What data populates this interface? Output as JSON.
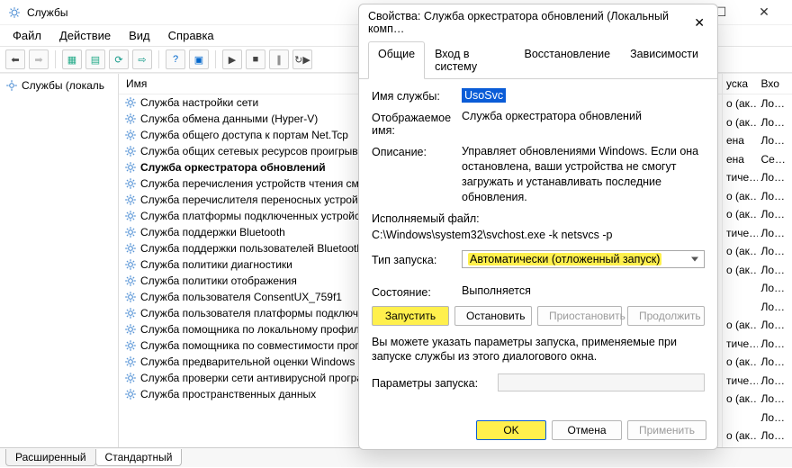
{
  "window": {
    "title": "Службы",
    "menu": [
      "Файл",
      "Действие",
      "Вид",
      "Справка"
    ]
  },
  "tree": {
    "root": "Службы (локаль"
  },
  "list_header": "Имя",
  "services": [
    "Служба настройки сети",
    "Служба обмена данными (Hyper-V)",
    "Служба общего доступа к портам Net.Tcp",
    "Служба общих сетевых ресурсов проигрыва…",
    "Служба оркестратора обновлений",
    "Служба перечисления устройств чтения см…",
    "Служба перечислителя переносных устройст…",
    "Служба платформы подключенных устройст…",
    "Служба поддержки Bluetooth",
    "Служба поддержки пользователей Bluetooth_…",
    "Служба политики диагностики",
    "Служба политики отображения",
    "Служба пользователя ConsentUX_759f1",
    "Служба пользователя платформы подключ…",
    "Служба помощника по локальному профил…",
    "Служба помощника по совместимости прогр…",
    "Служба предварительной оценки Windows",
    "Служба проверки сети антивирусной програ…",
    "Служба пространственных данных"
  ],
  "bold_index": 4,
  "bottom_tabs": {
    "extended": "Расширенный",
    "standard": "Стандартный"
  },
  "far_cols": {
    "h1": "уска",
    "h2": "Вхо",
    "rows": [
      [
        "о (ак…",
        "Ло…"
      ],
      [
        "о (ак…",
        "Ло…"
      ],
      [
        "ена",
        "Ло…"
      ],
      [
        "ена",
        "Се…"
      ],
      [
        "тиче…",
        "Ло…"
      ],
      [
        "о (ак…",
        "Ло…"
      ],
      [
        "о (ак…",
        "Ло…"
      ],
      [
        "тиче…",
        "Ло…"
      ],
      [
        "о (ак…",
        "Ло…"
      ],
      [
        "о (ак…",
        "Ло…"
      ],
      [
        "",
        "Ло…"
      ],
      [
        "",
        "Ло…"
      ],
      [
        "о (ак…",
        "Ло…"
      ],
      [
        "тиче…",
        "Ло…"
      ],
      [
        "о (ак…",
        "Ло…"
      ],
      [
        "тиче…",
        "Ло…"
      ],
      [
        "о (ак…",
        "Ло…"
      ],
      [
        "",
        "Ло…"
      ],
      [
        "о (ак…",
        "Ло…"
      ]
    ]
  },
  "dialog": {
    "title": "Свойства: Служба оркестратора обновлений (Локальный комп…",
    "tabs": [
      "Общие",
      "Вход в систему",
      "Восстановление",
      "Зависимости"
    ],
    "labels": {
      "svc_name": "Имя службы:",
      "display_name": "Отображаемое имя:",
      "description": "Описание:",
      "exe": "Исполняемый файл:",
      "startup": "Тип запуска:",
      "state": "Состояние:",
      "params": "Параметры запуска:",
      "hint": "Вы можете указать параметры запуска, применяемые при запуске службы из этого диалогового окна."
    },
    "values": {
      "svc_name": "UsoSvc",
      "display_name": "Служба оркестратора обновлений",
      "description": "Управляет обновлениями Windows. Если она остановлена, ваши устройства не смогут загружать и устанавливать последние обновления.",
      "exe": "C:\\Windows\\system32\\svchost.exe -k netsvcs -p",
      "startup": "Автоматически (отложенный запуск)",
      "state": "Выполняется"
    },
    "buttons": {
      "start": "Запустить",
      "stop": "Остановить",
      "pause": "Приостановить",
      "resume": "Продолжить",
      "ok": "OK",
      "cancel": "Отмена",
      "apply": "Применить"
    }
  }
}
